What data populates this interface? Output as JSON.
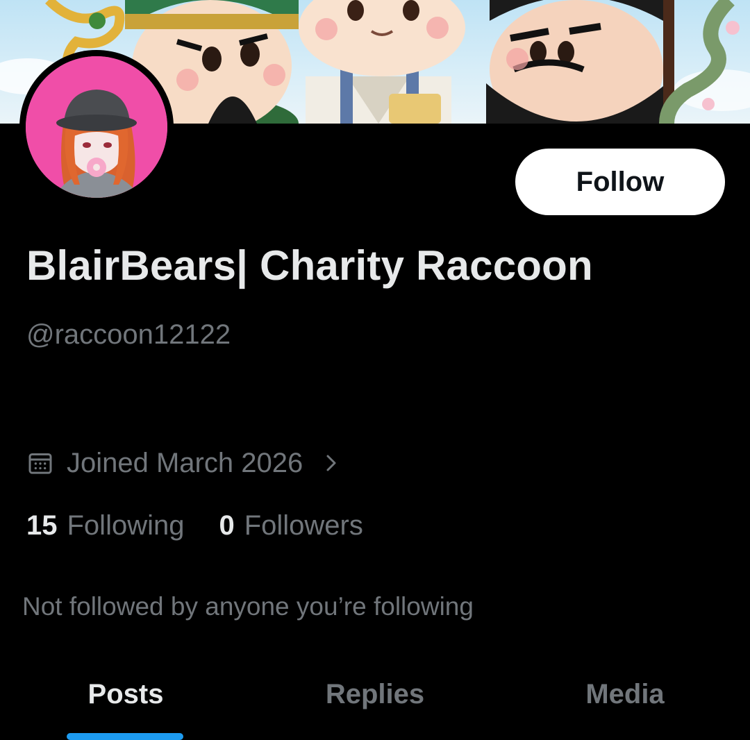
{
  "profile": {
    "display_name": "BlairBears| Charity Raccoon",
    "handle": "@raccoon12122",
    "joined": "Joined March 2026",
    "following_count": "15",
    "following_label": "Following",
    "followers_count": "0",
    "followers_label": "Followers",
    "not_followed_text": "Not followed by anyone you’re following"
  },
  "actions": {
    "follow_label": "Follow"
  },
  "tabs": [
    {
      "label": "Posts",
      "active": true
    },
    {
      "label": "Replies",
      "active": false
    },
    {
      "label": "Media",
      "active": false
    }
  ],
  "icons": {
    "calendar": "calendar-icon",
    "chevron": "chevron-right-icon"
  },
  "colors": {
    "background": "#000000",
    "primary_text": "#e7e9ea",
    "secondary_text": "#71767b",
    "accent": "#1d9bf0",
    "follow_button_bg": "#ffffff",
    "avatar_bg": "#f04ea8"
  }
}
